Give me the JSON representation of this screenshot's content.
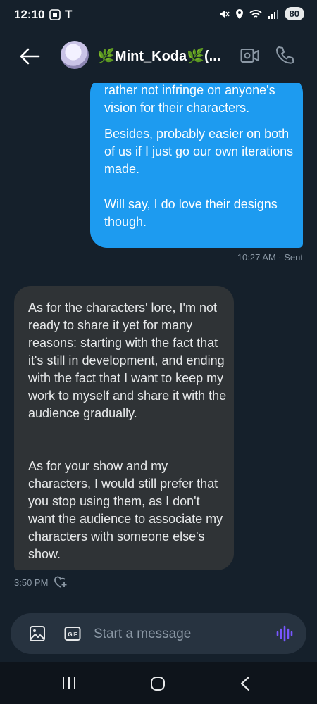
{
  "status_bar": {
    "time": "12:10",
    "carrier_icon": "T",
    "battery": "80"
  },
  "header": {
    "contact_name": "🌿Mint_Koda🌿(...",
    "icons": [
      "back-arrow-icon",
      "video-call-icon",
      "phone-call-icon"
    ]
  },
  "messages": [
    {
      "direction": "sent",
      "paragraphs": [
        "rather not infringe on anyone's vision for their characters.",
        "Besides, probably easier on both of us if I just go our own iterations made.",
        "Will say, I do love their designs though."
      ],
      "meta": "10:27 AM · Sent"
    },
    {
      "direction": "received",
      "paragraphs": [
        "As for the characters' lore, I'm not ready to share it yet for many reasons: starting with the fact that it's still in development, and ending with the fact that I want to keep my work to myself and share it with the audience gradually.",
        "As for your show and my characters, I would still prefer that you stop using them, as I don't want the audience to associate my characters with someone else's show."
      ],
      "meta": "3:50 PM"
    }
  ],
  "composer": {
    "placeholder": "Start a message",
    "gif_label": "GIF"
  },
  "colors": {
    "background": "#15202b",
    "sent_bubble": "#1d9bf0",
    "received_bubble": "#2f3336",
    "composer": "#273340",
    "voice_accent": "#7856ff"
  }
}
